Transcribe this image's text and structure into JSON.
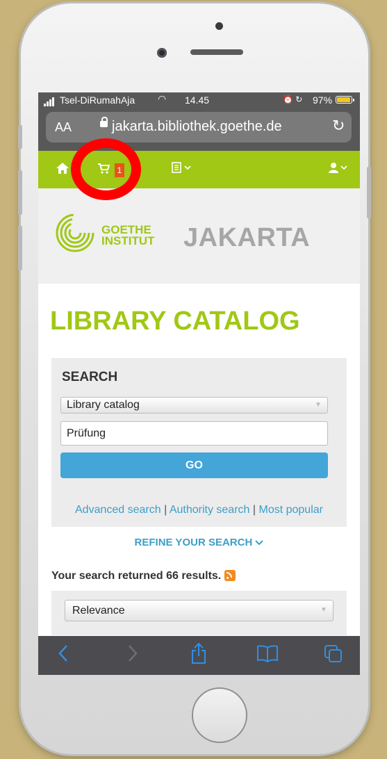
{
  "status_bar": {
    "carrier": "Tsel-DiRumahAja",
    "time": "14.45",
    "battery": "97%",
    "battery_level": 0.97,
    "icons": [
      "signal-icon",
      "wifi-icon",
      "alarm-icon",
      "rotation-lock-icon",
      "battery-icon"
    ]
  },
  "browser": {
    "text_size_label": "AA",
    "url": "jakarta.bibliothek.goethe.de"
  },
  "nav": {
    "cart_count": "1",
    "icons": [
      "home-icon",
      "cart-icon",
      "lists-icon",
      "user-icon"
    ]
  },
  "header": {
    "logo_line1": "GOETHE",
    "logo_line2": "INSTITUT",
    "city": "JAKARTA"
  },
  "page_title": "LIBRARY CATALOG",
  "search": {
    "label": "SEARCH",
    "scope": "Library catalog",
    "query": "Prüfung",
    "go_label": "GO",
    "links": [
      "Advanced search",
      "Authority search",
      "Most popular"
    ],
    "separator": "|"
  },
  "refine_label": "REFINE YOUR SEARCH",
  "results_text": "Your search returned 66 results.",
  "sort": {
    "value": "Relevance"
  },
  "toolbar": {
    "icons": [
      "back-icon",
      "forward-icon",
      "share-icon",
      "bookmarks-icon",
      "tabs-icon"
    ]
  },
  "colors": {
    "brand_green": "#a0c814",
    "link_blue": "#3d9ec8",
    "button_blue": "#44a5d8",
    "badge_orange": "#e8541a",
    "annotation_red": "#ff0000",
    "ios_blue": "#2f8fe6"
  }
}
